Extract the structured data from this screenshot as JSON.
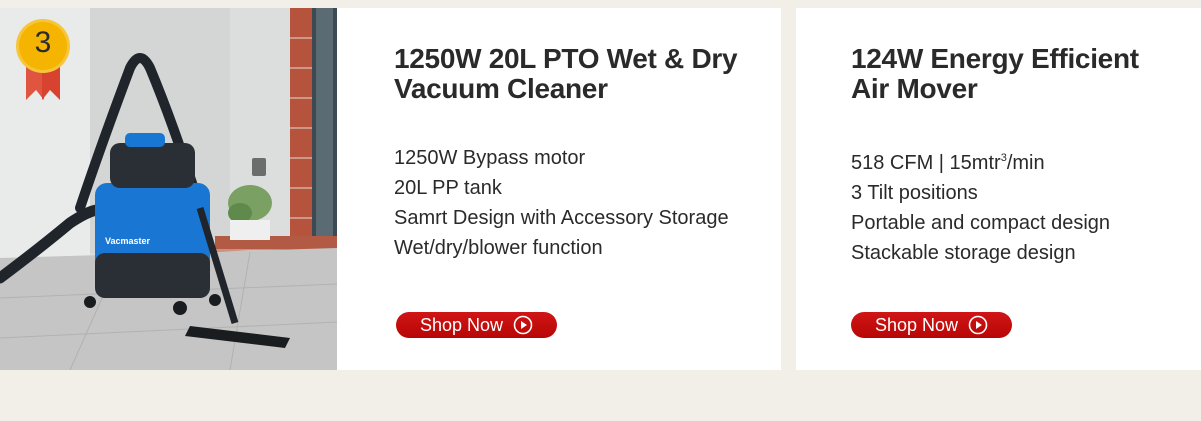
{
  "badge": {
    "rank": "3"
  },
  "photo": {
    "brand": "Vacmaster"
  },
  "products": [
    {
      "title_line1": "1250W 20L PTO Wet & Dry",
      "title_line2": "Vacuum Cleaner",
      "features": [
        "1250W Bypass motor",
        "20L PP tank",
        "Samrt Design with Accessory Storage",
        "Wet/dry/blower function"
      ],
      "cta": "Shop Now"
    },
    {
      "title_line1": "124W Energy Efficient",
      "title_line2": "Air Mover",
      "features": [
        "518 CFM | 15mtr",
        "3 Tilt positions",
        "Portable and compact design",
        "Stackable storage design"
      ],
      "feature_sup": "3",
      "feature_suffix": "/min",
      "cta": "Shop Now"
    }
  ],
  "colors": {
    "background": "#f2efe9",
    "card": "#ffffff",
    "button": "#c40e0e",
    "badge": "#f4b400",
    "ribbon": "#e0553f",
    "vacuum_blue": "#1976d2"
  }
}
